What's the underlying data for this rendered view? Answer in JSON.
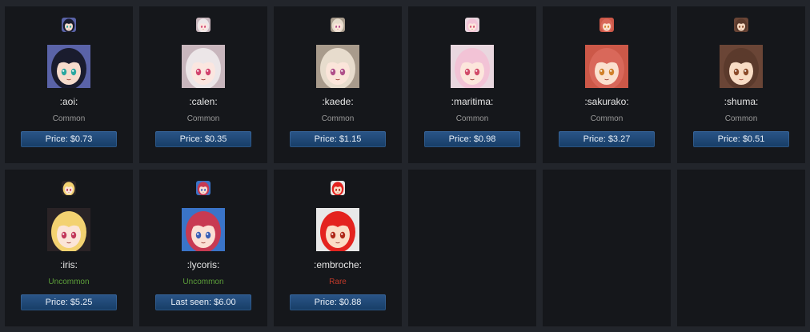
{
  "colors": {
    "page_bg": "#22252b",
    "card_bg": "#15171b",
    "button": "#1d4776",
    "common": "#9a9a9a",
    "uncommon": "#5c9e3a",
    "rare": "#c33a2a"
  },
  "items": [
    {
      "name": ":aoi:",
      "rarity": "Common",
      "rarity_color": "#9a9a9a",
      "price": "Price: $0.73",
      "hair": "#1a1c2e",
      "skin": "#f6dccd",
      "eyes": "#2aa7a0",
      "bg": "#5a63a8"
    },
    {
      "name": ":calen:",
      "rarity": "Common",
      "rarity_color": "#9a9a9a",
      "price": "Price: $0.35",
      "hair": "#ece6e8",
      "skin": "#fbe6e0",
      "eyes": "#d2436e",
      "bg": "#c8b6bd"
    },
    {
      "name": ":kaede:",
      "rarity": "Common",
      "rarity_color": "#9a9a9a",
      "price": "Price: $1.15",
      "hair": "#e7dccd",
      "skin": "#fbe5da",
      "eyes": "#b04f8a",
      "bg": "#a89b8c"
    },
    {
      "name": ":maritima:",
      "rarity": "Common",
      "rarity_color": "#9a9a9a",
      "price": "Price: $0.98",
      "hair": "#f2c3d6",
      "skin": "#fce6dc",
      "eyes": "#d24c6a",
      "bg": "#e9d7df"
    },
    {
      "name": ":sakurako:",
      "rarity": "Common",
      "rarity_color": "#9a9a9a",
      "price": "Price: $3.27",
      "hair": "#d9685a",
      "skin": "#fbe1cf",
      "eyes": "#d0802a",
      "bg": "#cc5848"
    },
    {
      "name": ":shuma:",
      "rarity": "Common",
      "rarity_color": "#9a9a9a",
      "price": "Price: $0.51",
      "hair": "#5b3a2c",
      "skin": "#f8dcc5",
      "eyes": "#8a4a2a",
      "bg": "#6a4536"
    },
    {
      "name": ":iris:",
      "rarity": "Uncommon",
      "rarity_color": "#5c9e3a",
      "price": "Price: $5.25",
      "hair": "#f3d271",
      "skin": "#fbe5d8",
      "eyes": "#c2385a",
      "bg": "#2a2326"
    },
    {
      "name": ":lycoris:",
      "rarity": "Uncommon",
      "rarity_color": "#5c9e3a",
      "price": "Last seen: $6.00",
      "hair": "#c83a52",
      "skin": "#fbe0d4",
      "eyes": "#3a5fb5",
      "bg": "#3a74c8"
    },
    {
      "name": ":embroche:",
      "rarity": "Rare",
      "rarity_color": "#c33a2a",
      "price": "Price: $0.88",
      "hair": "#e4231f",
      "skin": "#fbddc7",
      "eyes": "#b02818",
      "bg": "#e8e8e8"
    },
    {
      "empty": true
    },
    {
      "empty": true
    },
    {
      "empty": true
    }
  ]
}
